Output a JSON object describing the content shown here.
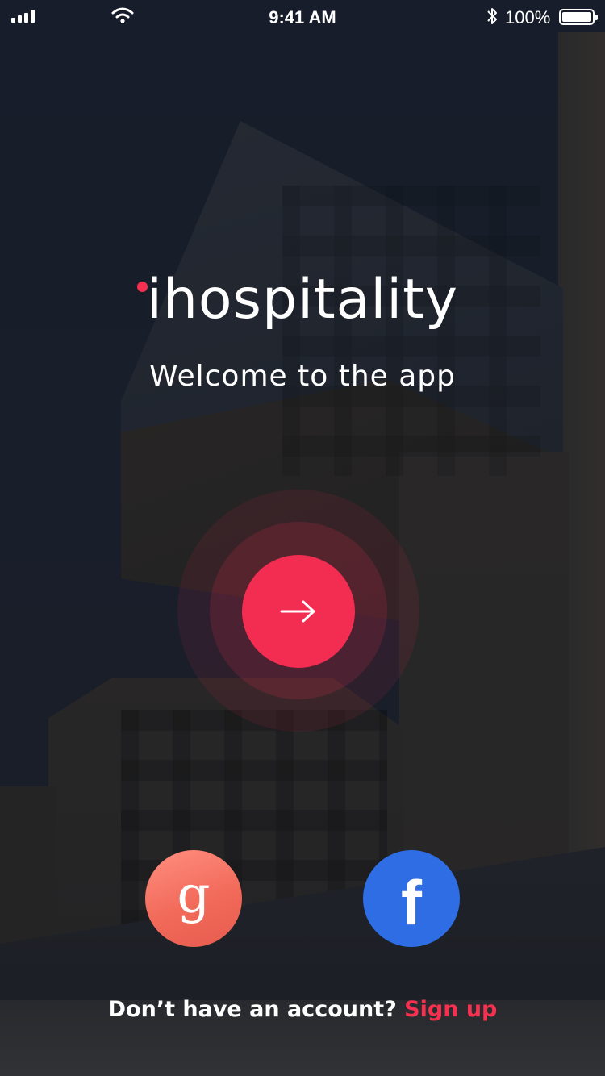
{
  "status_bar": {
    "time": "9:41 AM",
    "battery_percent": "100%",
    "battery_level": 1.0,
    "signal_icon": "cellular-signal-icon",
    "wifi_icon": "wifi-icon",
    "bluetooth_icon": "bluetooth-icon"
  },
  "brand": {
    "name": "ihospitality",
    "accent_color": "#f6304f"
  },
  "welcome": {
    "subtitle": "Welcome to the app"
  },
  "continue_button": {
    "icon": "arrow-right-icon",
    "color": "#f32d52"
  },
  "social": {
    "google": {
      "icon": "google-icon",
      "glyph": "g",
      "color": "#f26a5a"
    },
    "facebook": {
      "icon": "facebook-icon",
      "glyph": "f",
      "color": "#2f6de4"
    }
  },
  "signup": {
    "prompt": "Don’t have an account?",
    "link": "Sign up"
  }
}
